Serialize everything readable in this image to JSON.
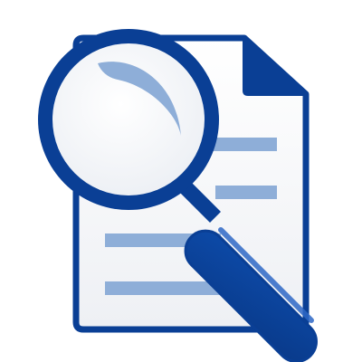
{
  "icon": {
    "name": "document-search-icon",
    "parts": [
      "document-icon",
      "magnifying-glass-icon"
    ]
  },
  "colors": {
    "primary_blue": "#0a3f95",
    "light_blue_lines": "#8eaed8",
    "document_fill": "#f5f6f8",
    "lens_fill": "#f7f8fa",
    "lens_glare": "#8eaed8",
    "handle_highlight": "#2e67c6"
  }
}
